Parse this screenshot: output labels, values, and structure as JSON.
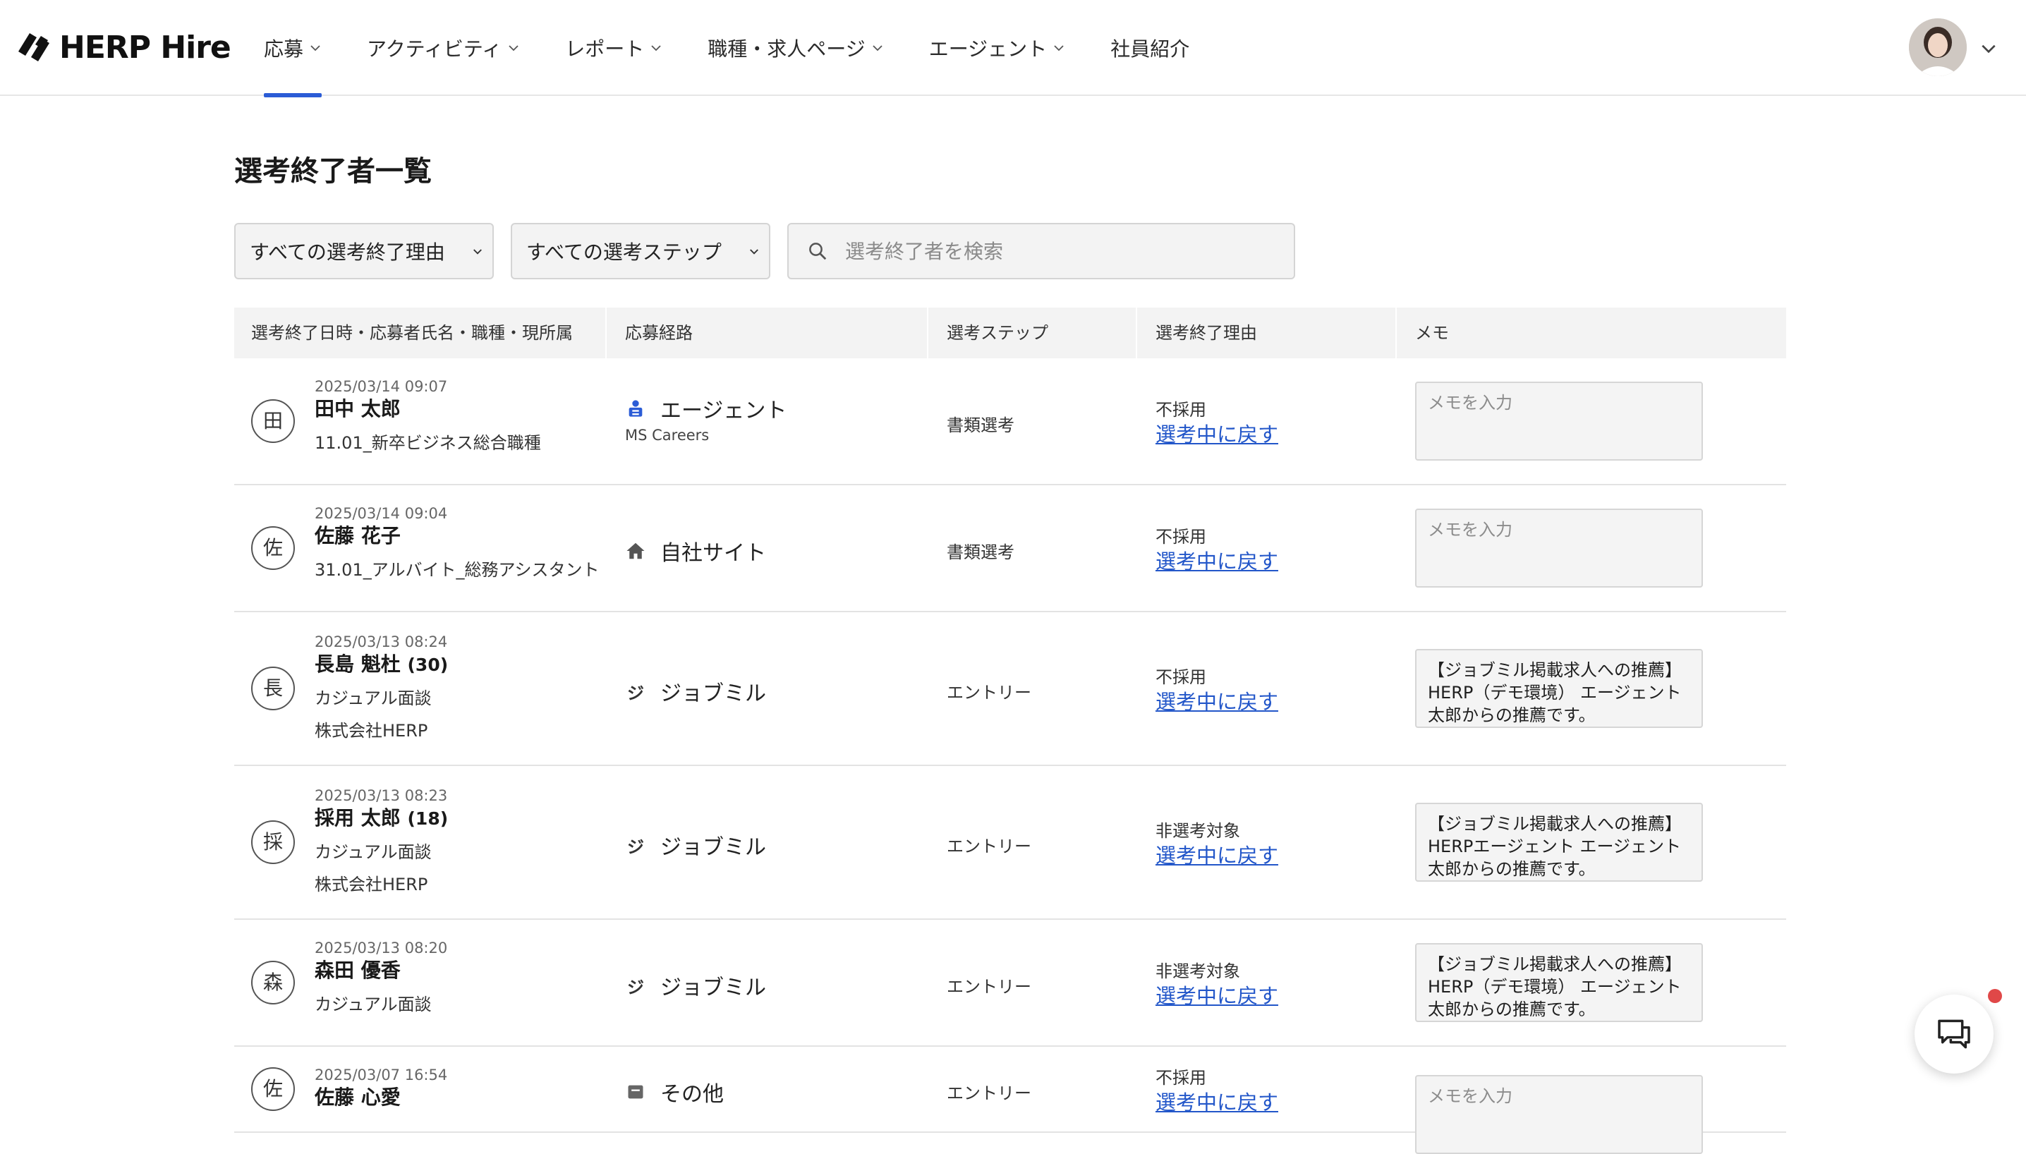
{
  "app": {
    "logo_text": "HERP Hire"
  },
  "nav": {
    "items": [
      {
        "label": "応募",
        "dropdown": true,
        "active": true
      },
      {
        "label": "アクティビティ",
        "dropdown": true
      },
      {
        "label": "レポート",
        "dropdown": true
      },
      {
        "label": "職種・求人ページ",
        "dropdown": true
      },
      {
        "label": "エージェント",
        "dropdown": true
      },
      {
        "label": "社員紹介",
        "dropdown": false
      }
    ]
  },
  "page": {
    "title": "選考終了者一覧"
  },
  "filters": {
    "reason_select": "すべての選考終了理由",
    "step_select": "すべての選考ステップ",
    "search_placeholder": "選考終了者を検索"
  },
  "table": {
    "headers": [
      "選考終了日時・応募者氏名・職種・現所属",
      "応募経路",
      "選考ステップ",
      "選考終了理由",
      "メモ"
    ],
    "back_label": "選考中に戻す",
    "rows": [
      {
        "initial": "田",
        "date": "2025/03/14 09:07",
        "name": "田中 太郎",
        "age": "",
        "job": "11.01_新卒ビジネス総合職種",
        "company": "",
        "route": "エージェント",
        "route_icon": "agent-icon",
        "route_sub": "MS Careers",
        "step": "書類選考",
        "reason": "不採用",
        "memo": "",
        "memo_placeholder": "メモを入力"
      },
      {
        "initial": "佐",
        "date": "2025/03/14 09:04",
        "name": "佐藤 花子",
        "age": "",
        "job": "31.01_アルバイト_総務アシスタント",
        "company": "",
        "route": "自社サイト",
        "route_icon": "home-icon",
        "route_sub": "",
        "step": "書類選考",
        "reason": "不採用",
        "memo": "",
        "memo_placeholder": "メモを入力"
      },
      {
        "initial": "長",
        "date": "2025/03/13 08:24",
        "name": "長島 魁杜",
        "age": "(30)",
        "job": "カジュアル面談",
        "company": "株式会社HERP",
        "route": "ジョブミル",
        "route_icon": "ジ",
        "route_sub": "",
        "step": "エントリー",
        "reason": "不採用",
        "memo": "【ジョブミル掲載求人への推薦】HERP（デモ環境） エージェント 太郎からの推薦です。",
        "memo_placeholder": "メモを入力"
      },
      {
        "initial": "採",
        "date": "2025/03/13 08:23",
        "name": "採用 太郎",
        "age": "(18)",
        "job": "カジュアル面談",
        "company": "株式会社HERP",
        "route": "ジョブミル",
        "route_icon": "ジ",
        "route_sub": "",
        "step": "エントリー",
        "reason": "非選考対象",
        "memo": "【ジョブミル掲載求人への推薦】HERPエージェント エージェント 太郎からの推薦です。",
        "memo_placeholder": "メモを入力"
      },
      {
        "initial": "森",
        "date": "2025/03/13 08:20",
        "name": "森田 優香",
        "age": "",
        "job": "カジュアル面談",
        "company": "",
        "route": "ジョブミル",
        "route_icon": "ジ",
        "route_sub": "",
        "step": "エントリー",
        "reason": "非選考対象",
        "memo": "【ジョブミル掲載求人への推薦】HERP（デモ環境） エージェント 太郎からの推薦です。",
        "memo_placeholder": "メモを入力"
      },
      {
        "initial": "佐",
        "date": "2025/03/07 16:54",
        "name": "佐藤 心愛",
        "age": "",
        "job": "",
        "company": "",
        "route": "その他",
        "route_icon": "other-icon",
        "route_sub": "",
        "step": "エントリー",
        "reason": "不採用",
        "memo": "",
        "memo_placeholder": "メモを入力"
      }
    ]
  },
  "colors": {
    "accent": "#2b5cd6",
    "link": "#2256c9",
    "notification": "#e04848"
  }
}
